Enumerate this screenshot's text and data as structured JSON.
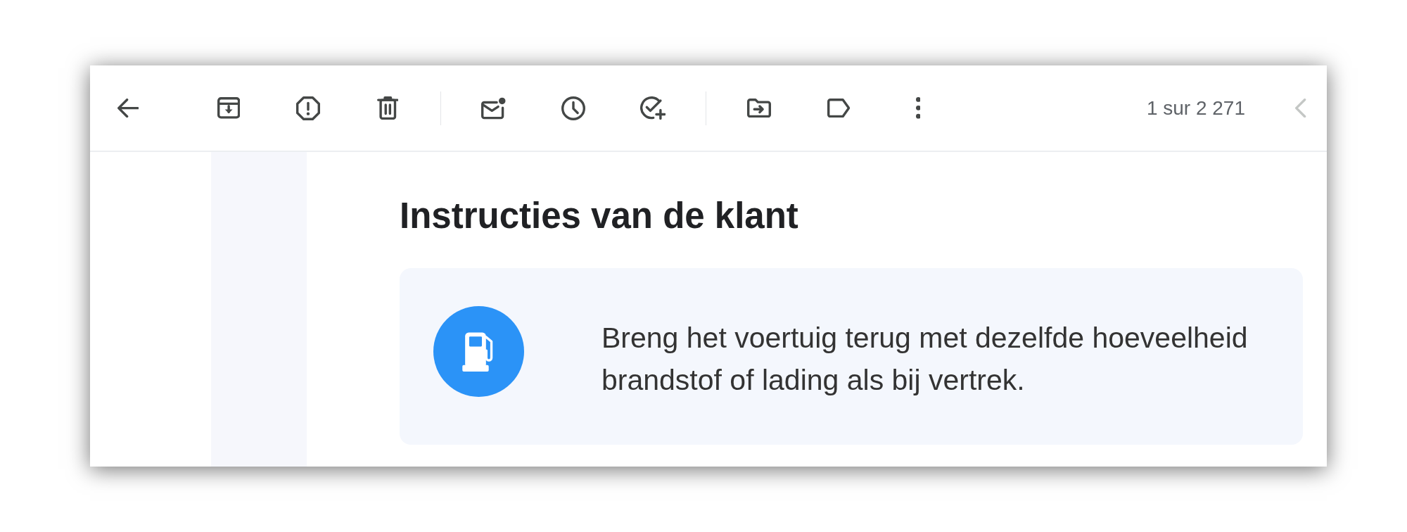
{
  "toolbar": {
    "groups": [
      [
        {
          "kind": "back"
        }
      ],
      [
        {
          "kind": "archive"
        },
        {
          "kind": "spam"
        },
        {
          "kind": "delete"
        }
      ],
      [
        {
          "kind": "unread"
        },
        {
          "kind": "snooze"
        },
        {
          "kind": "task"
        }
      ],
      [
        {
          "kind": "move"
        },
        {
          "kind": "label"
        },
        {
          "kind": "more"
        }
      ]
    ],
    "pager": {
      "text": "1 sur 2 271",
      "previous": {
        "disabled": true
      }
    }
  },
  "message": {
    "heading": "Instructies van de klant",
    "instructions": [
      {
        "kind": "fuel",
        "text": "Breng het voertuig terug met dezelfde hoeveelheid brandstof of lading als bij vertrek."
      }
    ]
  }
}
